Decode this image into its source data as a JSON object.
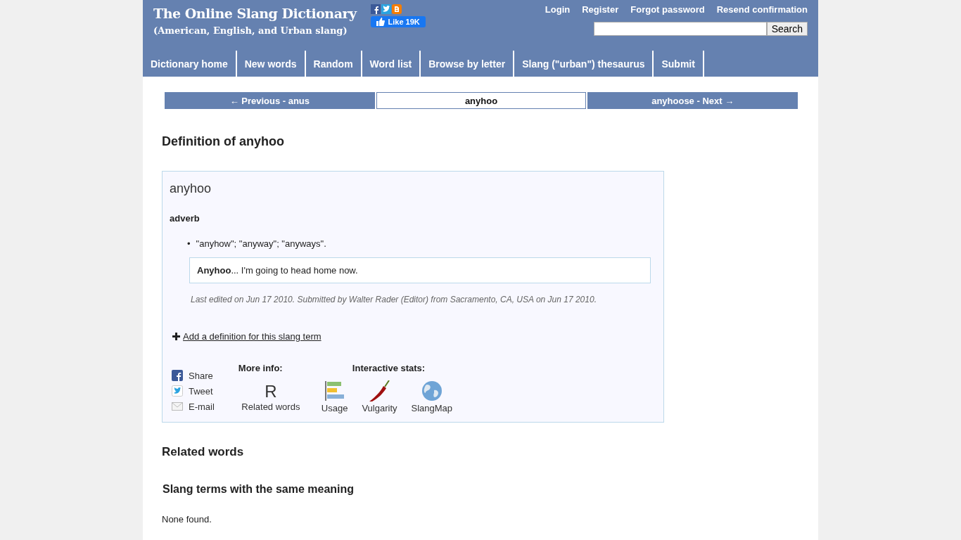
{
  "site": {
    "title": "The Online Slang Dictionary",
    "subtitle": "(American, English, and Urban slang)",
    "like": "Like 19K"
  },
  "account_links": [
    "Login",
    "Register",
    "Forgot password",
    "Resend confirmation"
  ],
  "search": {
    "button": "Search"
  },
  "nav": [
    "Dictionary home",
    "New words",
    "Random",
    "Word list",
    "Browse by letter",
    "Slang (\"urban\") thesaurus",
    "Submit"
  ],
  "pager": [
    {
      "label": "← Previous - anus",
      "selected": false
    },
    {
      "label": "anyhoo",
      "selected": true
    },
    {
      "label": "anyhoose - Next →",
      "selected": false
    }
  ],
  "heading": "Definition of anyhoo",
  "entry": {
    "word": "anyhoo",
    "part_of_speech": "adverb",
    "definitions": [
      {
        "bullet": "•",
        "text": "\"anyhow\"; \"anyway\"; \"anyways\"."
      }
    ],
    "example": "**Anyhoo**... I'm going to head home now.",
    "edited": "Last edited on Jun 17 2010. Submitted by Walter Rader (Editor) from Sacramento, CA, USA on Jun 17 2010.",
    "add_link": "Add a definition for this slang term"
  },
  "share": [
    {
      "kind": "facebook",
      "label": "Share"
    },
    {
      "kind": "twitter",
      "label": "Tweet"
    },
    {
      "kind": "email",
      "label": "E-mail"
    }
  ],
  "more_info": {
    "title": "More info:",
    "letter": "R",
    "label": "Related words"
  },
  "stats": {
    "title": "Interactive stats:",
    "items": [
      {
        "kind": "usage",
        "label": "Usage"
      },
      {
        "kind": "vulgarity",
        "label": "Vulgarity"
      },
      {
        "kind": "map",
        "label": "SlangMap"
      }
    ]
  },
  "related": {
    "heading": "Related words",
    "subheading": "Slang terms with the same meaning",
    "none": "None found."
  }
}
